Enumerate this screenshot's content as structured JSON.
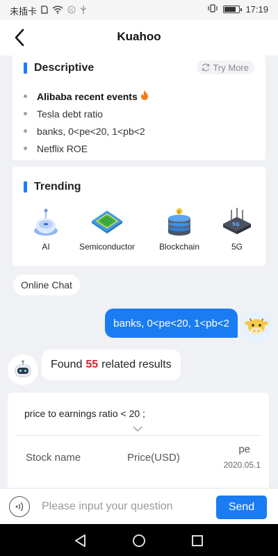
{
  "status_bar": {
    "carrier": "未插卡",
    "time": "17:19",
    "icons": [
      "sim-icon",
      "wifi-icon",
      "nfc-icon",
      "usb-icon",
      "vibrate-icon",
      "battery-icon"
    ]
  },
  "header": {
    "title": "Kuahoo",
    "back_icon": "chevron-left-icon"
  },
  "descriptive": {
    "title": "Descriptive",
    "try_more": "Try More",
    "items": [
      {
        "label": "Alibaba recent events",
        "hot": true
      },
      {
        "label": "Tesla debt ratio",
        "hot": false
      },
      {
        "label": "banks, 0<pe<20, 1<pb<2",
        "hot": false
      },
      {
        "label": "Netflix ROE",
        "hot": false
      }
    ]
  },
  "trending": {
    "title": "Trending",
    "items": [
      {
        "label": "AI",
        "icon": "ai-robot-icon"
      },
      {
        "label": "Semiconductor",
        "icon": "chip-icon"
      },
      {
        "label": "Blockchain",
        "icon": "blockchain-icon"
      },
      {
        "label": "5G",
        "icon": "router-5g-icon"
      }
    ]
  },
  "chat": {
    "online_chat_label": "Online Chat",
    "user_message": "banks, 0<pe<20, 1<pb<2",
    "bot_prefix": "Found",
    "bot_count": "55",
    "bot_suffix": "related results"
  },
  "result": {
    "condition": "price to earnings ratio < 20 ;",
    "columns": {
      "stock_name": "Stock name",
      "price": "Price(USD)",
      "pe": "pe",
      "pe_date": "2020.05.1"
    }
  },
  "input": {
    "placeholder": "Please input your question",
    "send_label": "Send"
  },
  "colors": {
    "accent": "#1a7cf2",
    "highlight": "#d6232a",
    "background": "#f0f1f4"
  }
}
